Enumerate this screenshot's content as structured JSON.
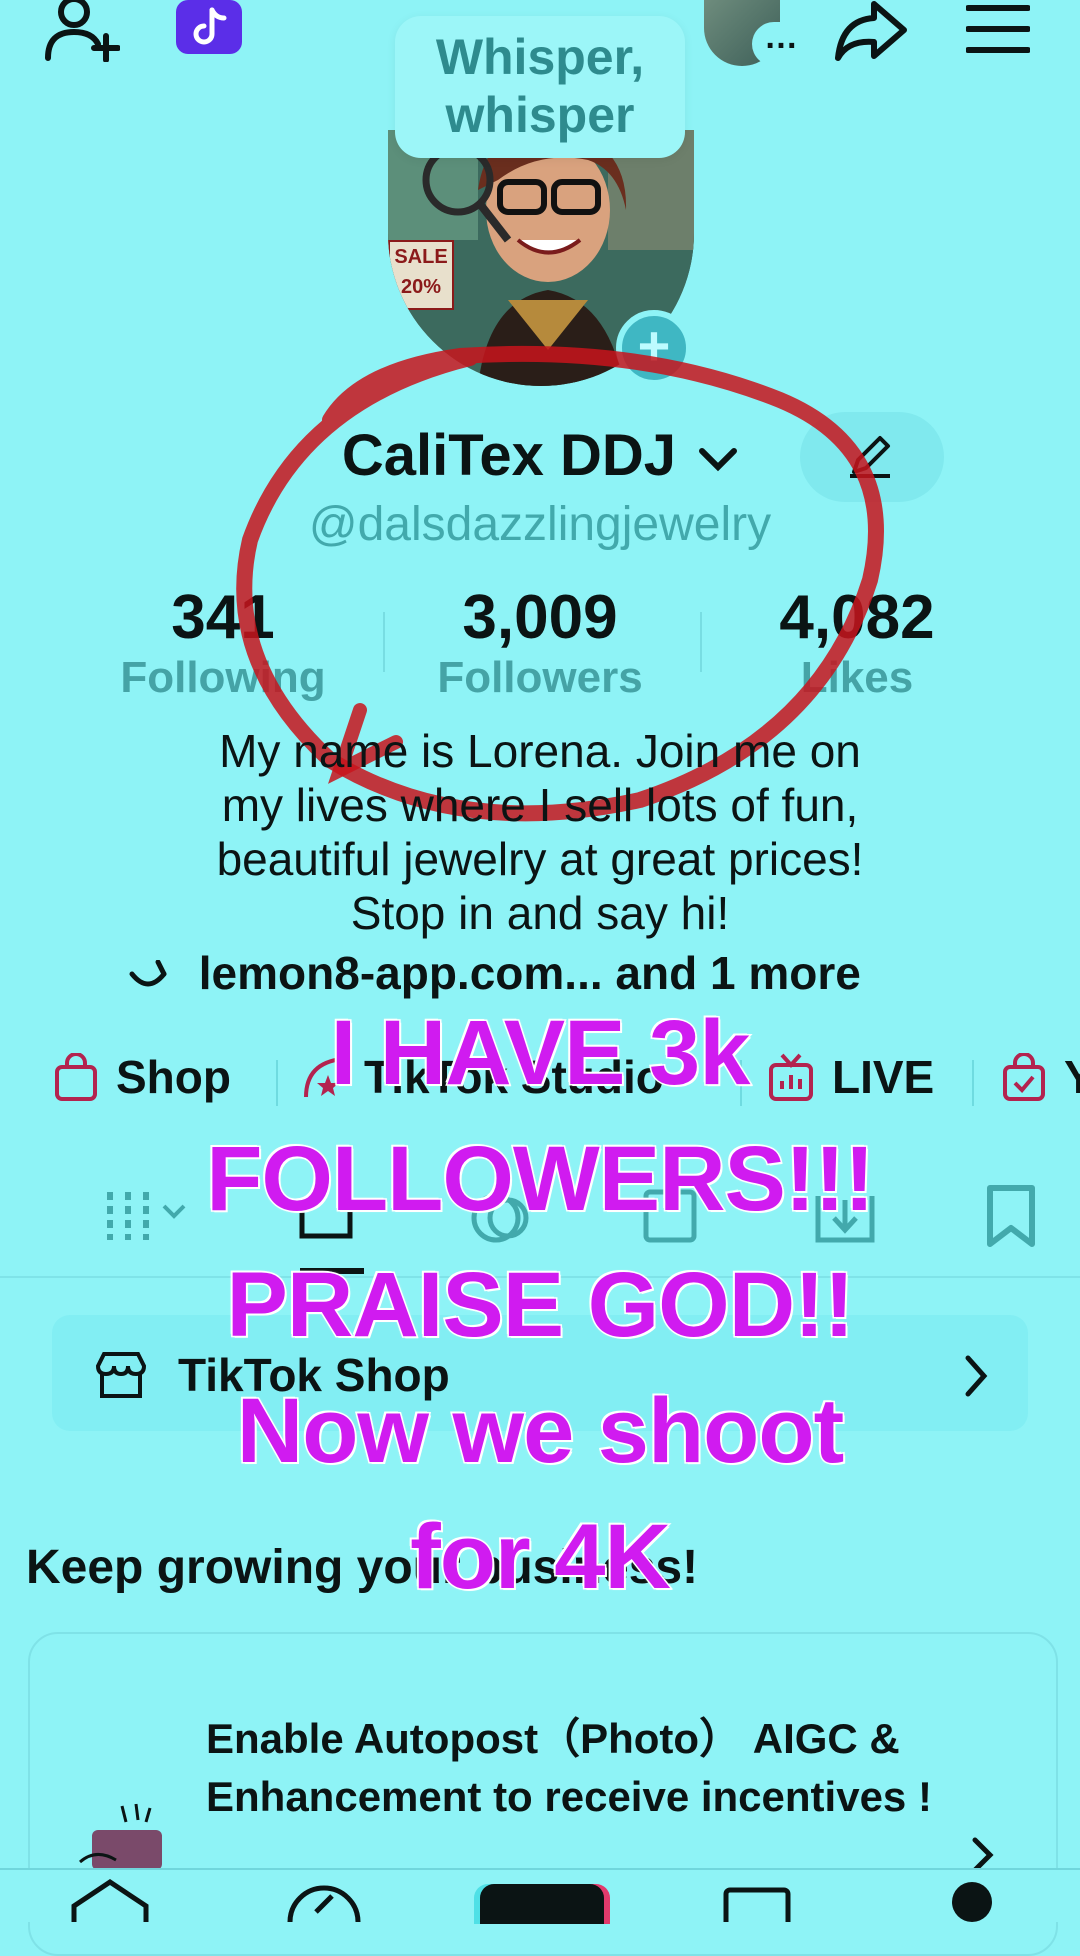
{
  "bubble_text": [
    "Whisper,",
    "whisper"
  ],
  "profile": {
    "name": "CaliTex DDJ",
    "handle": "@dalsdazzlingjewelry",
    "following_count": "341",
    "following_label": "Following",
    "followers_count": "3,009",
    "followers_label": "Followers",
    "likes_count": "4,082",
    "likes_label": "Likes",
    "bio": [
      "My name is Lorena. Join me on",
      "my lives where I sell lots of fun,",
      "beautiful jewelry at great prices!",
      "Stop in and say hi!"
    ],
    "link_text": "lemon8-app.com... and 1 more",
    "avatar_badge": [
      "SALE",
      "20%"
    ]
  },
  "tools": [
    {
      "label": "Shop",
      "icon": "shopping-bag-icon"
    },
    {
      "label": "TikTok Studio",
      "icon": "studio-star-icon"
    },
    {
      "label": "LIVE",
      "icon": "tv-icon"
    },
    {
      "label": "Y",
      "icon": "bag-check-icon"
    }
  ],
  "shop_card": {
    "label": "TikTok Shop"
  },
  "growth": {
    "heading": "Keep growing your business!",
    "card_text": "Enable Autopost（Photo） AIGC & Enhancement to receive incentives !"
  },
  "overlay_text": [
    "I HAVE 3k",
    "FOLLOWERS!!!",
    "PRAISE GOD!!",
    "Now we shoot",
    "for 4K"
  ],
  "colors": {
    "background": "#8ef3f6",
    "overlay_text": "#d01bf0",
    "circle_annotation": "#c8141c",
    "icon_accent": "#b3234f"
  }
}
